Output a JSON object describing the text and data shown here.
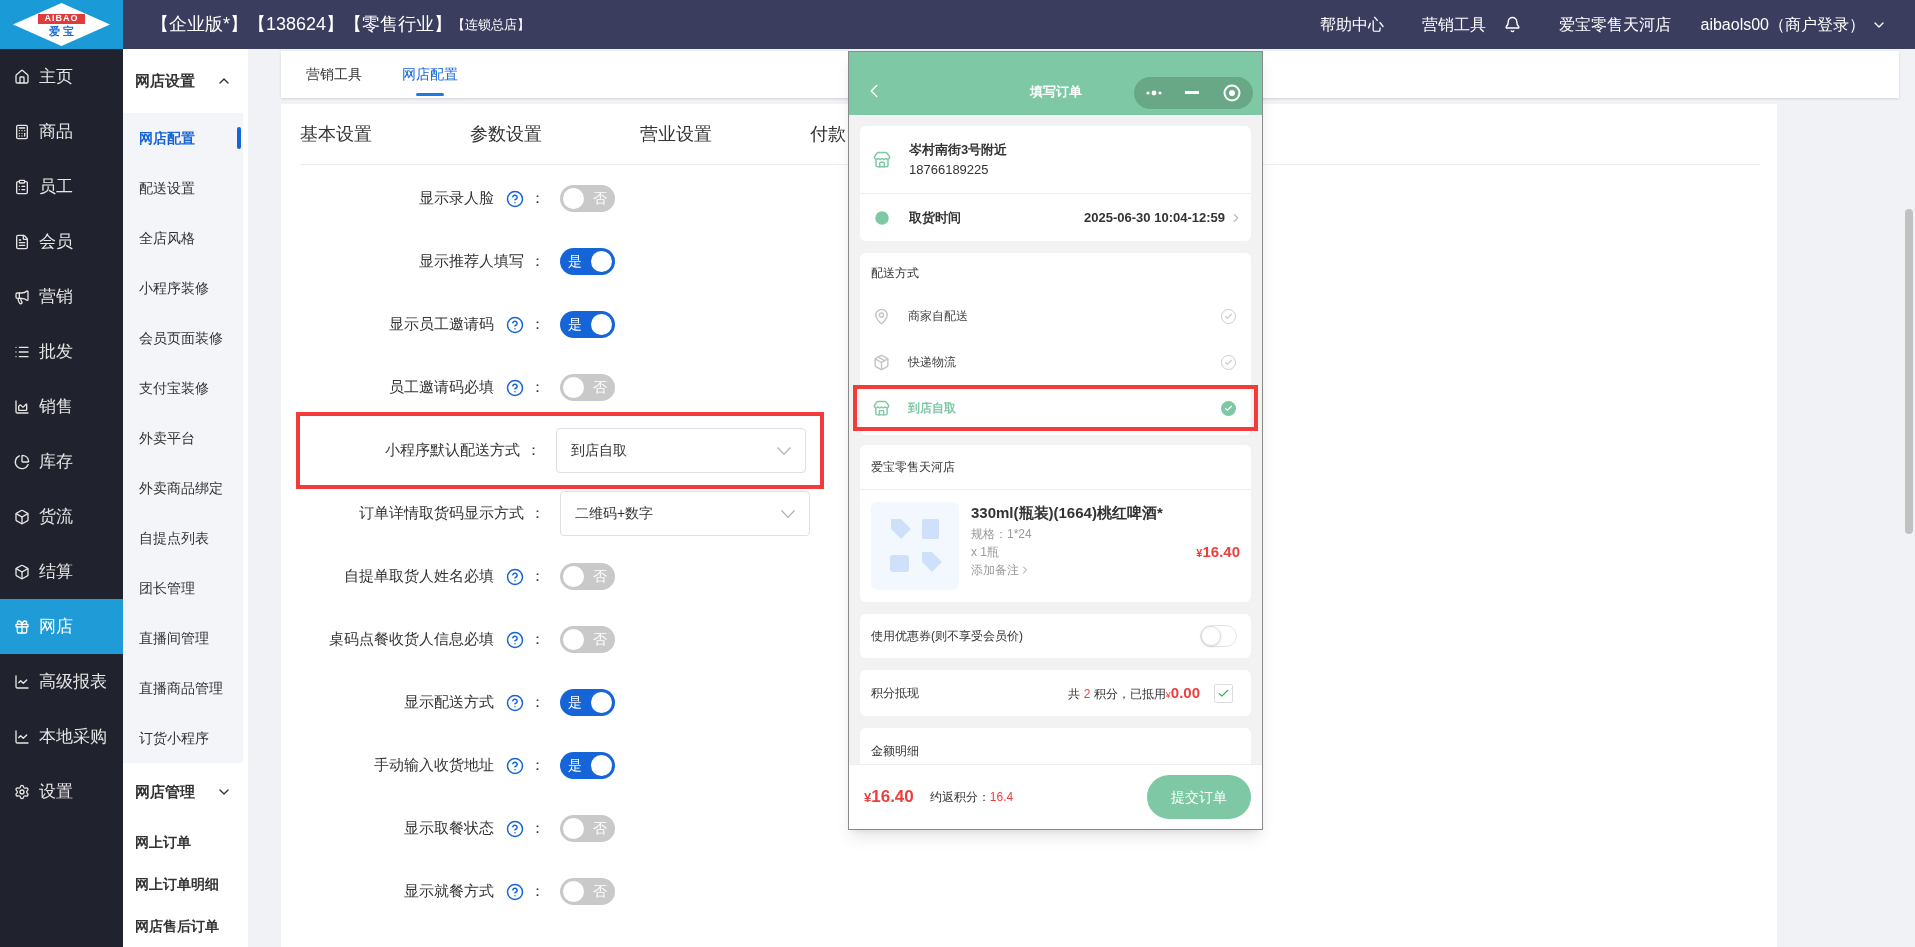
{
  "header": {
    "logo": {
      "latin": "AIBAO",
      "chinese": "爱 宝"
    },
    "title": "【企业版*】【138624】【零售行业】",
    "subtitle": "【连锁总店】",
    "links": [
      "帮助中心",
      "营销工具"
    ],
    "store": "爱宝零售天河店",
    "user": "aibaols00（商户登录）"
  },
  "sidebar": {
    "items": [
      {
        "label": "主页",
        "selected": false
      },
      {
        "label": "商品",
        "selected": false
      },
      {
        "label": "员工",
        "selected": false
      },
      {
        "label": "会员",
        "selected": false
      },
      {
        "label": "营销",
        "selected": false
      },
      {
        "label": "批发",
        "selected": false
      },
      {
        "label": "销售",
        "selected": false
      },
      {
        "label": "库存",
        "selected": false
      },
      {
        "label": "货流",
        "selected": false
      },
      {
        "label": "结算",
        "selected": false
      },
      {
        "label": "网店",
        "selected": true
      },
      {
        "label": "高级报表",
        "selected": false
      },
      {
        "label": "本地采购",
        "selected": false
      },
      {
        "label": "设置",
        "selected": false
      }
    ]
  },
  "subnav": {
    "sections": [
      {
        "label": "网店设置",
        "expanded": true,
        "items": [
          {
            "label": "网店配置",
            "selected": true
          },
          {
            "label": "配送设置",
            "selected": false
          },
          {
            "label": "全店风格",
            "selected": false
          },
          {
            "label": "小程序装修",
            "selected": false
          },
          {
            "label": "会员页面装修",
            "selected": false
          },
          {
            "label": "支付宝装修",
            "selected": false
          },
          {
            "label": "外卖平台",
            "selected": false
          },
          {
            "label": "外卖商品绑定",
            "selected": false
          },
          {
            "label": "自提点列表",
            "selected": false
          },
          {
            "label": "团长管理",
            "selected": false
          },
          {
            "label": "直播间管理",
            "selected": false
          },
          {
            "label": "直播商品管理",
            "selected": false
          },
          {
            "label": "订货小程序",
            "selected": false
          }
        ]
      },
      {
        "label": "网店管理",
        "expanded": false
      }
    ],
    "links": [
      "网上订单",
      "网上订单明细",
      "网店售后订单"
    ]
  },
  "top_tabs": [
    {
      "label": "营销工具",
      "selected": false
    },
    {
      "label": "网店配置",
      "selected": true
    }
  ],
  "settings_tabs": [
    "基本设置",
    "参数设置",
    "营业设置",
    "付款"
  ],
  "form": {
    "colon": "：",
    "rows": [
      {
        "kind": "toggle",
        "label": "显示录人脸",
        "help": true,
        "on": false,
        "text": "否"
      },
      {
        "kind": "toggle",
        "label": "显示推荐人填写",
        "help": false,
        "on": true,
        "text": "是"
      },
      {
        "kind": "toggle",
        "label": "显示员工邀请码",
        "help": true,
        "on": true,
        "text": "是"
      },
      {
        "kind": "toggle",
        "label": "员工邀请码必填",
        "help": true,
        "on": false,
        "text": "否"
      },
      {
        "kind": "select",
        "label": "小程序默认配送方式",
        "help": false,
        "value": "到店自取",
        "highlighted": true
      },
      {
        "kind": "select",
        "label": "订单详情取货码显示方式",
        "help": false,
        "value": "二维码+数字",
        "highlighted": false
      },
      {
        "kind": "toggle",
        "label": "自提单取货人姓名必填",
        "help": true,
        "on": false,
        "text": "否"
      },
      {
        "kind": "toggle",
        "label": "桌码点餐收货人信息必填",
        "help": true,
        "on": false,
        "text": "否"
      },
      {
        "kind": "toggle",
        "label": "显示配送方式",
        "help": true,
        "on": true,
        "text": "是"
      },
      {
        "kind": "toggle",
        "label": "手动输入收货地址",
        "help": true,
        "on": true,
        "text": "是"
      },
      {
        "kind": "toggle",
        "label": "显示取餐状态",
        "help": true,
        "on": false,
        "text": "否"
      },
      {
        "kind": "toggle",
        "label": "显示就餐方式",
        "help": true,
        "on": false,
        "text": "否"
      }
    ]
  },
  "phone": {
    "title": "填写订单",
    "address": {
      "name": "岑村南街3号附近",
      "phone": "18766189225"
    },
    "pickup": {
      "label": "取货时间",
      "value": "2025-06-30 10:04-12:59"
    },
    "delivery": {
      "title": "配送方式",
      "options": [
        {
          "label": "商家自配送",
          "selected": false,
          "highlighted": false
        },
        {
          "label": "快递物流",
          "selected": false,
          "highlighted": false
        },
        {
          "label": "到店自取",
          "selected": true,
          "highlighted": true
        }
      ]
    },
    "store": {
      "name": "爱宝零售天河店",
      "product": {
        "name": "330ml(瓶装)(1664)桃红啤酒*",
        "spec": "规格：1*24",
        "qty": "x 1瓶",
        "note": "添加备注",
        "currency": "¥",
        "price": "16.40"
      }
    },
    "coupon": {
      "label": "使用优惠券(则不享受会员价)",
      "on": false
    },
    "points": {
      "label": "积分抵现",
      "prefix": "共",
      "count": "2",
      "middle": "积分，已抵用",
      "currency": "¥",
      "amount": "0.00",
      "checked": true
    },
    "amount_detail": {
      "title": "金额明细"
    },
    "footer": {
      "currency": "¥",
      "total": "16.40",
      "points_label": "约返积分：",
      "points": "16.4",
      "submit": "提交订单"
    }
  }
}
